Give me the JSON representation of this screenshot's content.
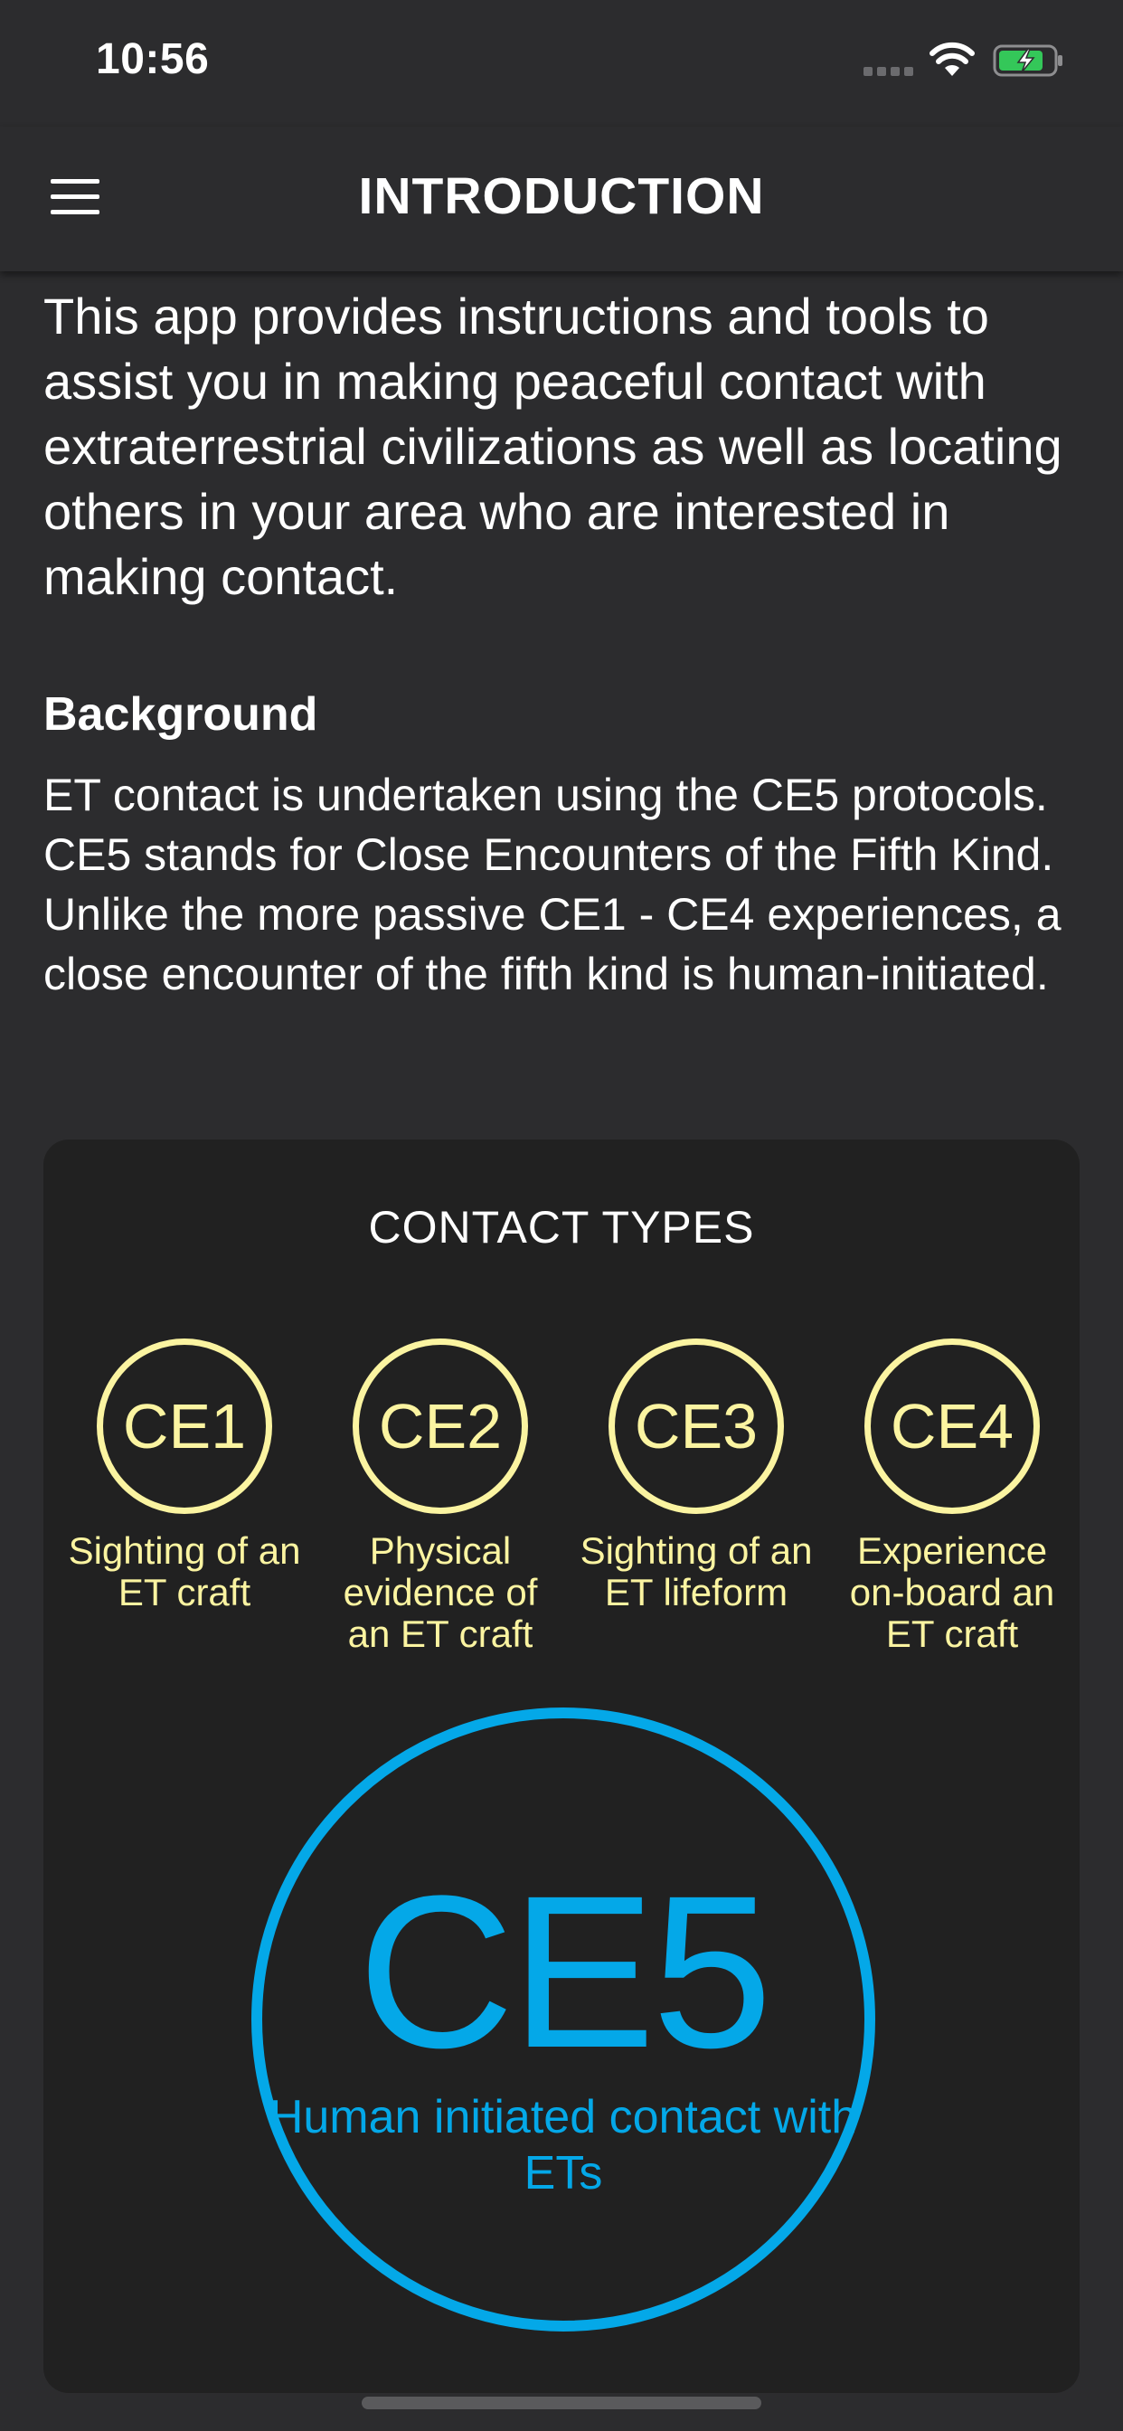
{
  "status_bar": {
    "time": "10:56",
    "wifi_icon": "wifi-icon",
    "battery_icon": "battery-charging-icon"
  },
  "nav": {
    "menu_icon": "hamburger-menu-icon",
    "title": "INTRODUCTION"
  },
  "content": {
    "intro": "This app provides instructions and tools to assist you in making peaceful contact with extraterrestrial civilizations as well as locating others in your area who are interested in making contact.",
    "background_heading": "Background",
    "background_text": "ET contact is undertaken using the CE5 protocols. CE5 stands for Close Encounters of the Fifth Kind. Unlike the more passive CE1 - CE4 experiences, a close encounter of the fifth kind is human-initiated."
  },
  "contact_types": {
    "title": "CONTACT TYPES",
    "items": [
      {
        "label": "CE1",
        "description": "Sighting of an ET craft"
      },
      {
        "label": "CE2",
        "description": "Physical evidence of an ET craft"
      },
      {
        "label": "CE3",
        "description": "Sighting of an ET lifeform"
      },
      {
        "label": "CE4",
        "description": "Experience on-board an ET craft"
      }
    ],
    "ce5": {
      "label": "CE5",
      "description": "Human initiated contact with ETs"
    }
  },
  "colors": {
    "background": "#2c2c2e",
    "card": "#212121",
    "ce1_4_accent": "#fbf4a1",
    "ce5_accent": "#04a8e8"
  }
}
